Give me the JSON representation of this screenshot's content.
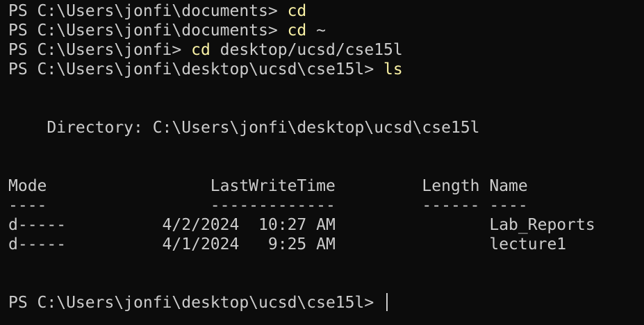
{
  "terminal": {
    "lines": [
      {
        "prompt": "PS C:\\Users\\jonfi\\documents> ",
        "cmd": "cd",
        "arg": ""
      },
      {
        "prompt": "PS C:\\Users\\jonfi\\documents> ",
        "cmd": "cd",
        "arg": " ~"
      },
      {
        "prompt": "PS C:\\Users\\jonfi> ",
        "cmd": "cd",
        "arg": " desktop/ucsd/cse15l"
      },
      {
        "prompt": "PS C:\\Users\\jonfi\\desktop\\ucsd\\cse15l> ",
        "cmd": "ls",
        "arg": ""
      }
    ],
    "directory_line": "    Directory: C:\\Users\\jonfi\\desktop\\ucsd\\cse15l",
    "header": "Mode                 LastWriteTime         Length Name",
    "separator": "----                 -------------         ------ ----",
    "rows": [
      "d-----          4/2/2024  10:27 AM                Lab_Reports",
      "d-----          4/1/2024   9:25 AM                lecture1"
    ],
    "final_prompt": "PS C:\\Users\\jonfi\\desktop\\ucsd\\cse15l> "
  },
  "colors": {
    "background": "#0c0c0c",
    "text": "#cccccc",
    "command": "#f9f1a5"
  }
}
